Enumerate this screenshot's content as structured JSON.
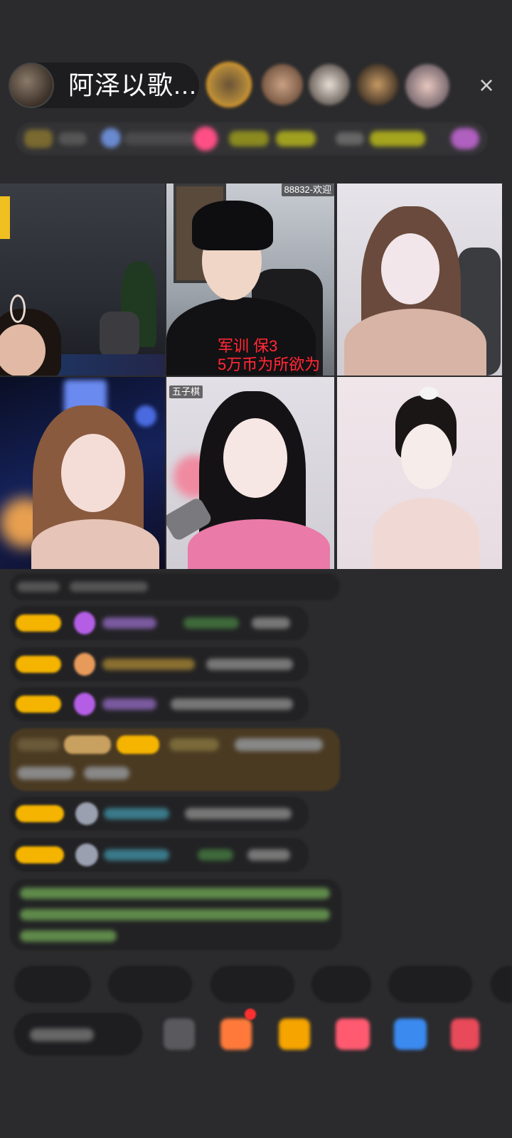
{
  "header": {
    "host_name": "阿泽以歌...",
    "close_icon": "×"
  },
  "grid": {
    "tiles": [
      {
        "id": "tile-1"
      },
      {
        "id": "tile-2",
        "overlay_line1": "军训   保3",
        "overlay_line2": "5万币为所欲为",
        "corner_tag": "88832-欢迎"
      },
      {
        "id": "tile-3"
      },
      {
        "id": "tile-4"
      },
      {
        "id": "tile-5",
        "corner_tag": "五子棋"
      },
      {
        "id": "tile-6"
      }
    ]
  },
  "colors": {
    "background": "#2b2b2d",
    "overlay_red": "#ff2a3a",
    "badge_yellow": "#f5b400",
    "accent_pink": "#ff4f86"
  }
}
